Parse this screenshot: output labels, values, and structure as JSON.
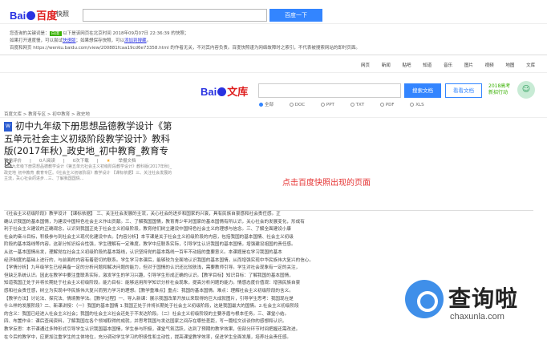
{
  "snapshot": {
    "logo_text_1": "Bai",
    "logo_text_2": "百度",
    "kuaizhao_label": "快照",
    "search_button": "百度一下",
    "info_line1_prefix": "您查询的关键词是：",
    "info_line1_kw": "百度",
    "info_line1_suffix": "以下是该网页在北京时间 2018年09月07日 22:36:39 的快照；",
    "info_line2_prefix": "如果打开速度慢，可以尝试",
    "info_line2_link1": "快速版",
    "info_line2_mid": "；如果想保存快照，可以",
    "info_line2_link2": "添加到搜藏",
    "info_line2_suffix": "。",
    "info_line3": "百度和网页 https://wenku.baidu.com/view/200881fcaa19cd6e73358.html 的作者无关，不对其内容负责。百度快照谨为网络故障时之索引，不代表被搜索网站的即时页面。"
  },
  "wenku": {
    "nav": [
      "网页",
      "新闻",
      "贴吧",
      "知道",
      "音乐",
      "图片",
      "视频",
      "地图",
      "文库"
    ],
    "logo_text_1": "Bai",
    "logo_text_2": "文库",
    "search_button": "搜索文档",
    "upload_button": "看看文档",
    "promo_line1": "2018高考",
    "promo_line2": "新招行动",
    "types": [
      "全部",
      "DOC",
      "PPT",
      "TXT",
      "PDF",
      "XLS"
    ]
  },
  "doc": {
    "breadcrumb": "百度文库 > 教育专区 > 初中教育 > 政史地",
    "title": "初中九年级下册思想品德教学设计《第五单元社会主义初级阶段教学设计》教科版(2017年秋)_政史地_初中教育_教育专区",
    "meta": [
      "暂无评价",
      "|",
      "0人阅读",
      "|",
      "0次下载",
      "|",
      "举报文档"
    ],
    "abstract": "初中九年级下册思想品德教学设计《第五单元社会主义初级阶段教学设计》教科版(2017年秋)_政史地_初中教育_教育专区。《社会主义初级阶段》教学设计 【课标依据】三、关注社会发展的主流，关心社会的进步...三、了解我国国情..."
  },
  "annotation": "点击百度快照出现的页面",
  "body_lines": [
    "《社会主义初级阶段》教学设计 【课标依据】 三、关注社会发展的主流，关心社会的进步和国家的兴衰，具有民族自豪感和社会责任感。正",
    "确认识我国的基本国情，为建设中国特色社会主义作出贡献。三、了解我国国情，教育青少年对国家的基本国情有所认识，关心社会的发展变化，形成有",
    "利于社会主义建设的正确观念，认识到我国正处于社会主义初级阶段，教育他们树立建设中国特色社会主义的理想与信念。三、了解全面建设小康",
    "社会的奋斗目标，积极参与到社会主义现代化建设中去。【内容分析】本节课是关于社会主义初级阶段的内容，包括我国的基本国情、社会主义初级",
    "阶段的基本路线等内容。这部分知识综合性强，学生理解有一定难度。教学中应联系实际，引导学生认识我国的基本国情，增强建设祖国的责任感。",
    "从这一基本国情出发，理解党在社会主义初级阶段的基本路线，认识坚持党的基本路线一百年不动摇的重要意义。本课题是在学习我国的基本",
    "经济制度的基础上进行的，与前面的内容有着密切的联系。学生学习本课后，能够较为全面地认识我国的基本国情，从而增强实现中华民族伟大复兴的信心。",
    "【学情分析】九年级学生已经具备一定的分析问题和解决问题的能力，但对于国情的认识还比较肤浅，需要教师引导。学生对社会现象有一定的关注，",
    "但缺乏系统认识。因此在教学中要注重联系实际，激发学生的学习兴趣，引导学生形成正确的认识。【教学目标】知识目标：了解我国的基本国情，",
    "知道我国正处于并将长期处于社会主义初级阶段。能力目标：能够运用所学知识分析社会现象，提高分析问题的能力。情感态度价值观：增强民族自豪",
    "感和社会责任感，树立为实现中华民族伟大复兴而努力学习的理想。【教学重难点】重点：我国的基本国情。难点：理解社会主义初级阶段的含义。",
    "【教学方法】讨论法、探究法、情境教学法。【教学过程】一、导入新课：展示我国改革开放以来取得的巨大成就图片，引导学生思考：我国现在是",
    "什么样的发展阶段？二、新课讲授：（一）我国的基本国情 1.我国正处于并将长期处于社会主义初级阶段，这是我国最大的国情。2.社会主义初级阶段",
    "的含义：我国已经进入社会主义社会；我国的社会主义社会还处于不发达阶段。（二）社会主义初级阶段的主要矛盾与根本任务。三、课堂小结。",
    "四、布置作业：课后查阅资料，了解我国在各个领域取得的成就，并思考我国与发达国家之间存在哪些差距，写一篇短文谈谈你的感想和认识。",
    "教学反思：本节课通过多种形式引导学生认识我国基本国情，学生参与积极，课堂气氛活跃，达到了预期的教学效果，但部分环节时间把握还需改进。",
    "在今后的教学中，应更加注重学生的主体地位，充分调动学生学习的积极性和主动性，提高课堂教学效率，促进学生全面发展，培养社会责任感。"
  ],
  "watermark": {
    "text": "查询啦",
    "url": "chaxunla.com"
  }
}
